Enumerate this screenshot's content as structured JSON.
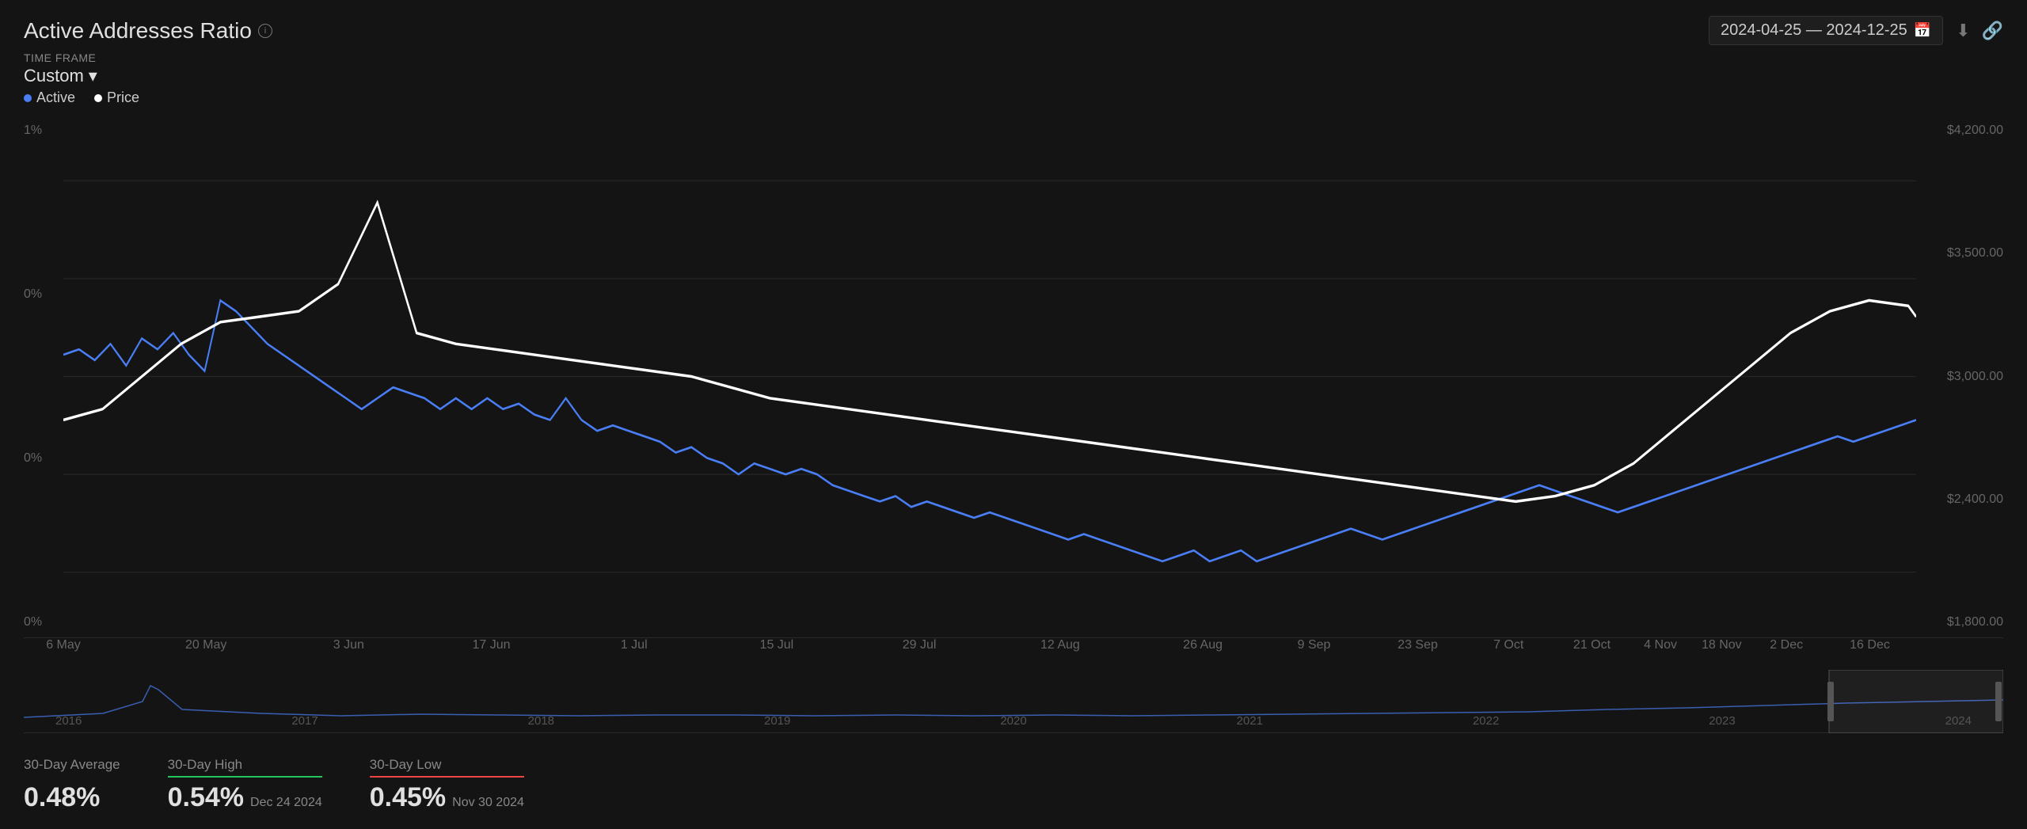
{
  "title": "Active Addresses Ratio",
  "dateRange": "2024-04-25 — 2024-12-25",
  "timeframe": {
    "label": "TIME FRAME",
    "value": "Custom"
  },
  "legend": [
    {
      "id": "active",
      "label": "Active",
      "color": "#4a7ef5"
    },
    {
      "id": "price",
      "label": "Price",
      "color": "#ffffff"
    }
  ],
  "yAxisLeft": [
    "1%",
    "0%",
    "0%",
    "0%"
  ],
  "yAxisRight": [
    "$4,200.00",
    "$3,500.00",
    "$3,000.00",
    "$2,400.00",
    "$1,800.00"
  ],
  "xAxisLabels": [
    {
      "label": "6 May",
      "pct": 0
    },
    {
      "label": "20 May",
      "pct": 7.7
    },
    {
      "label": "3 Jun",
      "pct": 15.4
    },
    {
      "label": "17 Jun",
      "pct": 23.1
    },
    {
      "label": "1 Jul",
      "pct": 30.8
    },
    {
      "label": "15 Jul",
      "pct": 38.5
    },
    {
      "label": "29 Jul",
      "pct": 46.2
    },
    {
      "label": "12 Aug",
      "pct": 53.8
    },
    {
      "label": "26 Aug",
      "pct": 61.5
    },
    {
      "label": "9 Sep",
      "pct": 67.5
    },
    {
      "label": "23 Sep",
      "pct": 73.1
    },
    {
      "label": "7 Oct",
      "pct": 78.0
    },
    {
      "label": "21 Oct",
      "pct": 82.0
    },
    {
      "label": "4 Nov",
      "pct": 86.2
    },
    {
      "label": "18 Nov",
      "pct": 89.5
    },
    {
      "label": "2 Dec",
      "pct": 93.0
    },
    {
      "label": "16 Dec",
      "pct": 97.5
    }
  ],
  "navigatorLabels": [
    "2016",
    "2017",
    "2018",
    "2019",
    "2020",
    "2021",
    "2022",
    "2023",
    "2024"
  ],
  "stats": [
    {
      "id": "avg",
      "label": "30-Day Average",
      "value": "0.48%",
      "date": "",
      "underlineColor": "transparent"
    },
    {
      "id": "high",
      "label": "30-Day High",
      "value": "0.54%",
      "date": "Dec 24 2024",
      "underlineColor": "#22c55e"
    },
    {
      "id": "low",
      "label": "30-Day Low",
      "value": "0.45%",
      "date": "Nov 30 2024",
      "underlineColor": "#ef4444"
    }
  ],
  "colors": {
    "background": "#141414",
    "gridLine": "#252525",
    "activeLine": "#4a7ef5",
    "priceLine": "#ffffff",
    "text": "#666666"
  }
}
